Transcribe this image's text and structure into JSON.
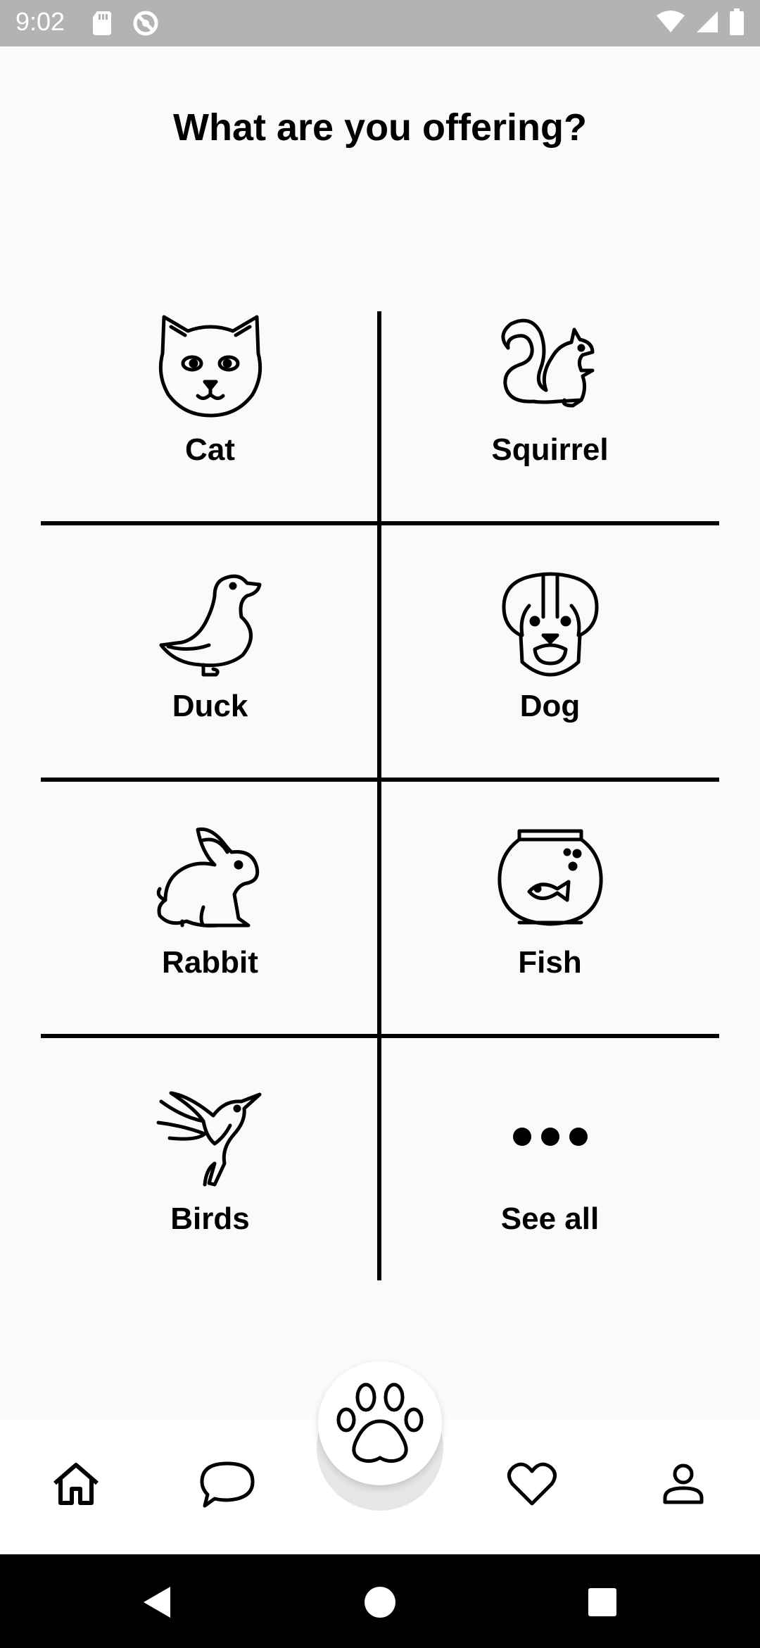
{
  "status_bar": {
    "time": "9:02",
    "icons": [
      "sd-card-icon",
      "sync-icon",
      "wifi-icon",
      "signal-icon",
      "battery-icon"
    ]
  },
  "page": {
    "title": "What are you offering?"
  },
  "categories": [
    {
      "label": "Cat",
      "icon": "cat-icon"
    },
    {
      "label": "Squirrel",
      "icon": "squirrel-icon"
    },
    {
      "label": "Duck",
      "icon": "duck-icon"
    },
    {
      "label": "Dog",
      "icon": "dog-icon"
    },
    {
      "label": "Rabbit",
      "icon": "rabbit-icon"
    },
    {
      "label": "Fish",
      "icon": "fishbowl-icon"
    },
    {
      "label": "Birds",
      "icon": "hummingbird-icon"
    },
    {
      "label": "See all",
      "icon": "more-dots-icon"
    }
  ],
  "bottom_nav": {
    "items": [
      "home-icon",
      "chat-icon",
      "paw-icon",
      "heart-icon",
      "person-icon"
    ]
  },
  "system_nav": [
    "back-icon",
    "home-circle-icon",
    "recents-icon"
  ]
}
